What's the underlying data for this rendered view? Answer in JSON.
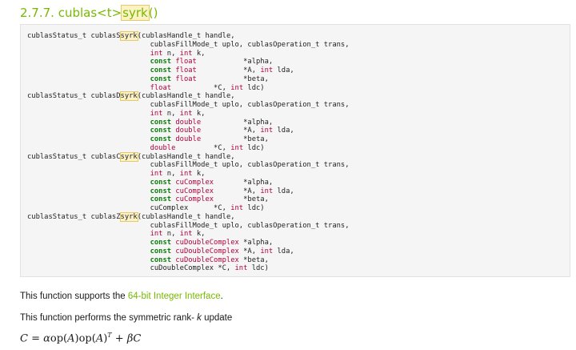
{
  "heading": {
    "number": "2.7.7. ",
    "prefix": "cublas<t>",
    "highlight": "syrk",
    "suffix": "()"
  },
  "code": [
    {
      "name": "cublasSsyrk",
      "pre": "cublasS",
      "fn": "syrk",
      "dtype": "float",
      "ptype": "float",
      "dtype_pad": "          ",
      "last_pad": "         "
    },
    {
      "name": "cublasDsyrk",
      "pre": "cublasD",
      "fn": "syrk",
      "dtype": "double",
      "ptype": "double",
      "dtype_pad": "         ",
      "last_pad": "        "
    },
    {
      "name": "cublasCsyrk",
      "pre": "cublasC",
      "fn": "syrk",
      "dtype": "cuComplex",
      "ptype": "cuComplex",
      "dtype_pad": "      ",
      "last_pad": "     "
    },
    {
      "name": "cublasZsyrk",
      "pre": "cublasZ",
      "fn": "syrk",
      "dtype": "cuDoubleComplex",
      "ptype": "cuDoubleComplex",
      "dtype_pad": "",
      "last_pad": ""
    }
  ],
  "code_text": {
    "return_type": "cublasStatus_t ",
    "handle": "(cublasHandle_t handle,",
    "uplo_trans": "cublasFillMode_t uplo, cublasOperation_t trans,",
    "int_kw": "int",
    "n_k_1": " n, ",
    "n_k_2": " k,",
    "const_kw": "const",
    "alpha": "*alpha,",
    "A": "*A, ",
    "lda": " lda,",
    "beta": "*beta,",
    "C": "*C, ",
    "ldc": " ldc)"
  },
  "para1": {
    "text": "This function supports the ",
    "link": "64-bit Integer Interface",
    "end": "."
  },
  "para2": {
    "text": "This function performs the symmetric rank- ",
    "k": "k",
    "end": " update"
  },
  "formula": "C = αop(A)op(A)^T + βC"
}
